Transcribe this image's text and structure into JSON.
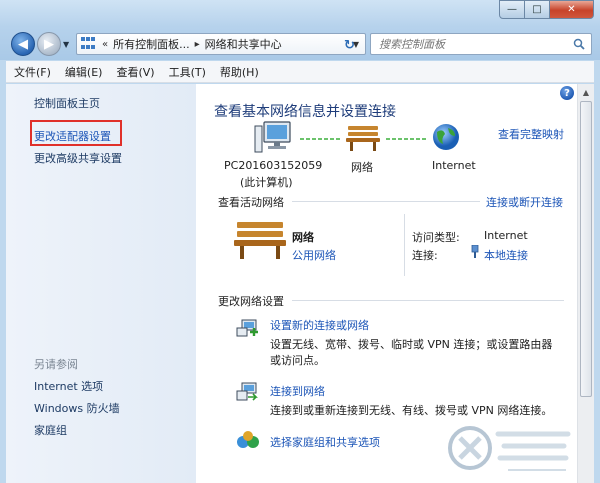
{
  "address": {
    "crumbs": [
      "所有控制面板...",
      "网络和共享中心"
    ]
  },
  "search": {
    "placeholder": "搜索控制面板"
  },
  "menu": [
    "文件(F)",
    "编辑(E)",
    "查看(V)",
    "工具(T)",
    "帮助(H)"
  ],
  "sidebar": {
    "items": [
      {
        "label": "控制面板主页",
        "style": "normal"
      },
      {
        "label": "更改适配器设置",
        "style": "link-highlighted"
      },
      {
        "label": "更改高级共享设置",
        "style": "normal"
      }
    ],
    "see_also_title": "另请参阅",
    "see_also": [
      "Internet 选项",
      "Windows 防火墙",
      "家庭组"
    ]
  },
  "main": {
    "title": "查看基本网络信息并设置连接",
    "full_map_link": "查看完整映射",
    "map_nodes": [
      {
        "label": "PC201603152059",
        "sublabel": "(此计算机)",
        "icon": "computer-icon"
      },
      {
        "label": "网络",
        "icon": "bench-icon"
      },
      {
        "label": "Internet",
        "icon": "globe-icon"
      }
    ],
    "active_networks_title": "查看活动网络",
    "connect_disconnect_link": "连接或断开连接",
    "network": {
      "name": "网络",
      "category": "公用网络",
      "access_type_label": "访问类型:",
      "access_type_value": "Internet",
      "connection_label": "连接:",
      "connection_value": "本地连接"
    },
    "change_settings_title": "更改网络设置",
    "tasks": [
      {
        "title": "设置新的连接或网络",
        "description": "设置无线、宽带、拨号、临时或 VPN 连接；或设置路由器或访问点。",
        "desc_lines": [
          "设置无线、宽带、拨号、临时或 VPN 连接；或设置路由器",
          "或访问点。"
        ]
      },
      {
        "title": "连接到网络",
        "description": "连接到或重新连接到无线、有线、拨号或 VPN 网络连接。"
      },
      {
        "title": "选择家庭组和共享选项",
        "description": ""
      }
    ]
  },
  "colors": {
    "link": "#1c55b7",
    "title": "#1e3c7a",
    "highlight_box": "#e0302a",
    "sidebar_bg": "#e6eef8"
  }
}
